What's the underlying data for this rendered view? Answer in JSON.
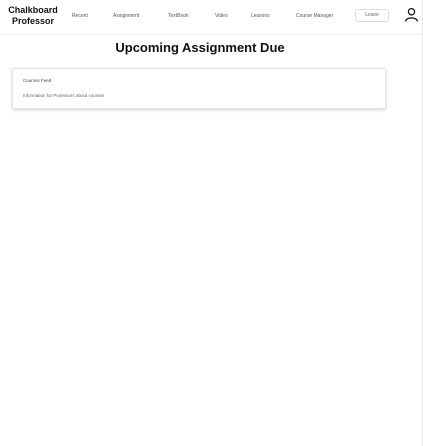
{
  "navbar": {
    "brand_line1": "Chalkboard",
    "brand_line2": "Professor",
    "links": [
      {
        "label": "Recent"
      },
      {
        "label": "Assignment"
      },
      {
        "label": "TextBook"
      },
      {
        "label": "Video"
      },
      {
        "label": "Lessons"
      },
      {
        "label": "Course Manager"
      }
    ],
    "leave_label": "Leave",
    "user_icon": "user-icon"
  },
  "main": {
    "title": "Upcoming Assignment Due",
    "cards": [
      {
        "title": "Courses Feed",
        "description": "Information for Professors about courses"
      }
    ]
  }
}
